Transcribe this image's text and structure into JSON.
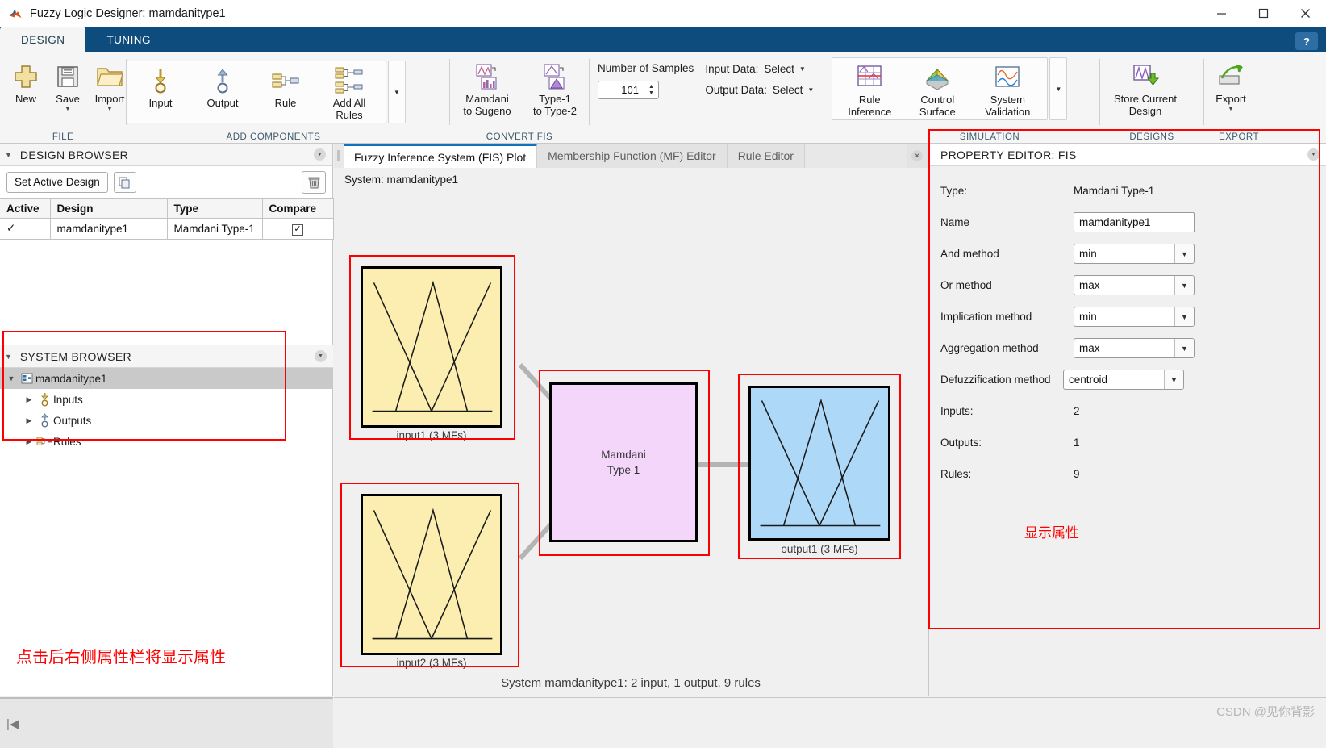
{
  "window": {
    "title": "Fuzzy Logic Designer: mamdanitype1",
    "app_icon": "matlab-icon",
    "minimize": "minimize-icon",
    "maximize": "maximize-icon",
    "close": "close-icon"
  },
  "ribbon_tabs": {
    "design": "DESIGN",
    "tuning": "TUNING",
    "help": "?"
  },
  "ribbon": {
    "file": {
      "title": "FILE",
      "buttons": [
        {
          "label": "New",
          "icon": "plus-icon",
          "caret": false
        },
        {
          "label": "Save",
          "icon": "save-disk-icon",
          "caret": true
        },
        {
          "label": "Import",
          "icon": "folder-icon",
          "caret": true
        }
      ]
    },
    "add_components": {
      "title": "ADD COMPONENTS",
      "buttons": [
        {
          "label": "Input",
          "icon": "input-arrow-icon"
        },
        {
          "label": "Output",
          "icon": "output-arrow-icon"
        },
        {
          "label": "Rule",
          "icon": "rule-icon"
        },
        {
          "label": "Add All\nRules",
          "icon": "add-all-rules-icon"
        }
      ],
      "expander": "expand-components-icon"
    },
    "convert_fis": {
      "title": "CONVERT FIS",
      "buttons": [
        {
          "label": "Mamdani\nto Sugeno",
          "icon": "mamdani-to-sugeno-icon"
        },
        {
          "label": "Type-1\nto Type-2",
          "icon": "type1-to-type2-icon"
        }
      ]
    },
    "simulation": {
      "title": "SIMULATION",
      "number_of_samples_label": "Number of Samples",
      "number_of_samples_value": "101",
      "input_data_label": "Input Data:",
      "input_data_value": "Select",
      "output_data_label": "Output Data:",
      "output_data_value": "Select",
      "buttons": [
        {
          "label": "Rule\nInference",
          "icon": "rule-inference-icon"
        },
        {
          "label": "Control\nSurface",
          "icon": "control-surface-icon"
        },
        {
          "label": "System\nValidation",
          "icon": "system-validation-icon"
        }
      ],
      "expander": "expand-simulation-icon"
    },
    "designs": {
      "title": "DESIGNS",
      "buttons": [
        {
          "label": "Store Current\nDesign",
          "icon": "store-design-icon"
        }
      ]
    },
    "export": {
      "title": "EXPORT",
      "buttons": [
        {
          "label": "Export",
          "icon": "export-icon",
          "caret": true
        }
      ]
    }
  },
  "design_browser": {
    "title": "DESIGN BROWSER",
    "collapse_icon": "chevron-down-icon",
    "options_icon": "panel-options-icon",
    "set_active_design": "Set Active Design",
    "copy_icon": "copy-icon",
    "delete_icon": "trash-icon",
    "columns": [
      "Active",
      "Design",
      "Type",
      "Compare"
    ],
    "rows": [
      {
        "active": "✓",
        "design": "mamdanitype1",
        "type": "Mamdani Type-1",
        "compare": true
      }
    ]
  },
  "system_browser": {
    "title": "SYSTEM BROWSER",
    "collapse_icon": "chevron-down-icon",
    "options_icon": "panel-options-icon",
    "tree": [
      {
        "label": "mamdanitype1",
        "icon": "fis-node-icon",
        "expanded": true,
        "selected": true,
        "depth": 0
      },
      {
        "label": "Inputs",
        "icon": "inputs-node-icon",
        "expanded": false,
        "selected": false,
        "depth": 1
      },
      {
        "label": "Outputs",
        "icon": "outputs-node-icon",
        "expanded": false,
        "selected": false,
        "depth": 1
      },
      {
        "label": "Rules",
        "icon": "rules-node-icon",
        "expanded": false,
        "selected": false,
        "depth": 1
      }
    ]
  },
  "annotations": {
    "left_note": "点击后右侧属性栏将显示属性",
    "right_note": "显示属性",
    "highlight_color": "#ff0000"
  },
  "document_tabs": {
    "tabs": [
      {
        "label": "Fuzzy Inference System (FIS) Plot",
        "active": true
      },
      {
        "label": "Membership Function (MF) Editor",
        "active": false
      },
      {
        "label": "Rule Editor",
        "active": false
      }
    ],
    "close_icon": "close-tab-icon"
  },
  "fis_plot": {
    "system_line": "System: mamdanitype1",
    "status": "System mamdanitype1: 2 input, 1 output, 9 rules",
    "blocks": [
      {
        "id": "input1",
        "label": "input1 (3 MFs)",
        "kind": "input",
        "color": "#fbeeb0"
      },
      {
        "id": "input2",
        "label": "input2 (3 MFs)",
        "kind": "input",
        "color": "#fbeeb0"
      },
      {
        "id": "engine",
        "label": "Mamdani\nType 1",
        "kind": "engine",
        "color": "#f4d6fb"
      },
      {
        "id": "output1",
        "label": "output1 (3 MFs)",
        "kind": "output",
        "color": "#aed8f8"
      }
    ]
  },
  "property_editor": {
    "title": "PROPERTY EDITOR: FIS",
    "options_icon": "panel-options-icon",
    "rows": [
      {
        "label": "Type:",
        "value": "Mamdani Type-1",
        "kind": "static"
      },
      {
        "label": "Name",
        "value": "mamdanitype1",
        "kind": "text"
      },
      {
        "label": "And method",
        "value": "min",
        "kind": "select"
      },
      {
        "label": "Or method",
        "value": "max",
        "kind": "select"
      },
      {
        "label": "Implication method",
        "value": "min",
        "kind": "select"
      },
      {
        "label": "Aggregation method",
        "value": "max",
        "kind": "select"
      },
      {
        "label": "Defuzzification method",
        "value": "centroid",
        "kind": "select"
      },
      {
        "label": "Inputs:",
        "value": "2",
        "kind": "static"
      },
      {
        "label": "Outputs:",
        "value": "1",
        "kind": "static"
      },
      {
        "label": "Rules:",
        "value": "9",
        "kind": "static"
      }
    ]
  },
  "footer": {
    "nav_first_icon": "go-to-first-icon",
    "watermark": "CSDN @见你背影"
  }
}
